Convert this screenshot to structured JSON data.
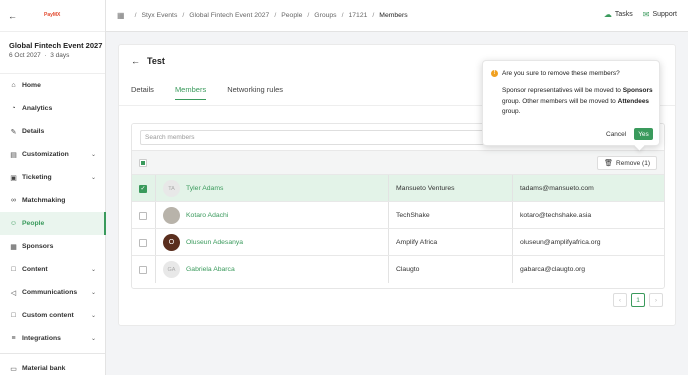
{
  "app": {
    "logo_text": "PayMX"
  },
  "event": {
    "title": "Global Fintech Event 2027",
    "date": "6 Oct 2027",
    "duration": "3 days",
    "dot": "·"
  },
  "sidebar": {
    "items": [
      {
        "label": "Home",
        "icon": "home-icon"
      },
      {
        "label": "Analytics",
        "icon": "analytics-icon"
      },
      {
        "label": "Details",
        "icon": "edit-icon"
      },
      {
        "label": "Customization",
        "icon": "paint-icon"
      },
      {
        "label": "Ticketing",
        "icon": "ticket-icon"
      },
      {
        "label": "Matchmaking",
        "icon": "link-icon"
      },
      {
        "label": "People",
        "icon": "people-icon"
      },
      {
        "label": "Sponsors",
        "icon": "grid-icon"
      },
      {
        "label": "Content",
        "icon": "folder-icon"
      },
      {
        "label": "Communications",
        "icon": "megaphone-icon"
      },
      {
        "label": "Custom content",
        "icon": "folder-icon"
      },
      {
        "label": "Integrations",
        "icon": "plug-icon"
      },
      {
        "label": "Material bank",
        "icon": "book-icon"
      }
    ]
  },
  "breadcrumb": {
    "items": [
      "Styx Events",
      "Global Fintech Event 2027",
      "People",
      "Groups",
      "17121",
      "Members"
    ]
  },
  "topbar": {
    "tasks": "Tasks",
    "support": "Support"
  },
  "page": {
    "title": "Test",
    "tabs": [
      "Details",
      "Members",
      "Networking rules"
    ],
    "search_placeholder": "Search members",
    "remove_label": "Remove (1)",
    "page_number": "1"
  },
  "members": [
    {
      "initials": "TA",
      "name": "Tyler Adams",
      "company": "Mansueto Ventures",
      "email": "tadams@mansueto.com",
      "selected": true
    },
    {
      "initials": "",
      "name": "Kotaro Adachi",
      "company": "TechShake",
      "email": "kotaro@techshake.asia",
      "selected": false
    },
    {
      "initials": "O",
      "name": "Oluseun Adesanya",
      "company": "Amplify Africa",
      "email": "oluseun@amplifyafrica.org",
      "selected": false
    },
    {
      "initials": "GA",
      "name": "Gabriela Abarca",
      "company": "Claugto",
      "email": "gabarca@claugto.org",
      "selected": false
    }
  ],
  "popover": {
    "title": "Are you sure to remove these members?",
    "body_1": "Sponsor representatives will be moved to",
    "body_sponsors": "Sponsors",
    "body_2": " group. Other members will be moved to",
    "body_attendees": "Attendees",
    "body_3": " group.",
    "cancel": "Cancel",
    "yes": "Yes"
  },
  "colors": {
    "accent": "#3a9a5c",
    "warning": "#f0a020",
    "selected_row": "#e3f3e8",
    "logo": "#e24a2f"
  }
}
